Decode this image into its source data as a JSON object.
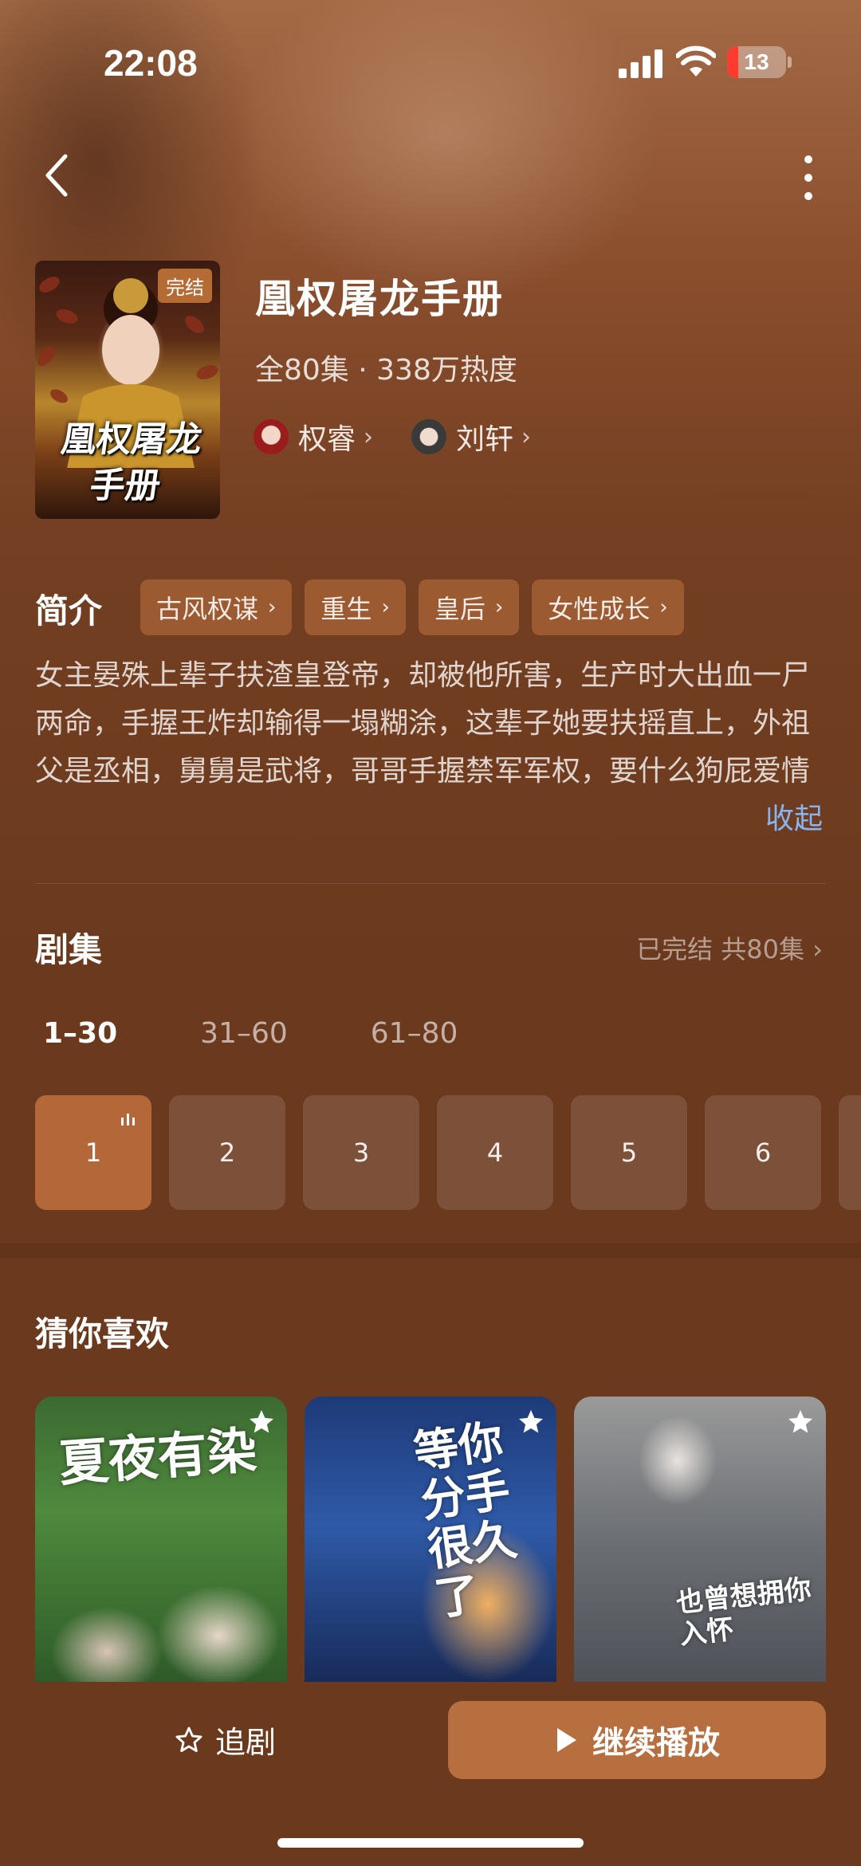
{
  "status_bar": {
    "time": "22:08",
    "battery": "13"
  },
  "show": {
    "title": "凰权屠龙手册",
    "poster_badge": "完结",
    "poster_title_line1": "凰权屠龙",
    "poster_title_line2": "手册",
    "meta": "全80集 · 338万热度",
    "cast": [
      {
        "name": "权睿"
      },
      {
        "name": "刘轩"
      }
    ]
  },
  "intro": {
    "label": "简介",
    "tags": [
      "古风权谋",
      "重生",
      "皇后",
      "女性成长"
    ],
    "synopsis": "女主晏殊上辈子扶渣皇登帝，却被他所害，生产时大出血一尸两命，手握王炸却输得一塌糊涂，这辈子她要扶摇直上，外祖父是丞相，舅舅是武将，哥哥手握禁军军权，要什么狗屁爱情",
    "collapse": "收起"
  },
  "episodes": {
    "title": "剧集",
    "status": "已完结 共80集",
    "ranges": [
      "1–30",
      "31–60",
      "61–80"
    ],
    "items": [
      "1",
      "2",
      "3",
      "4",
      "5",
      "6"
    ]
  },
  "recommend": {
    "title": "猜你喜欢",
    "cards": [
      {
        "art_text": "夏夜有染"
      },
      {
        "art_text": "等你分手很久了"
      },
      {
        "art_text": "也曾想拥你入怀"
      }
    ]
  },
  "actions": {
    "follow": "追剧",
    "continue": "继续播放"
  },
  "colors": {
    "accent": "#b86f3f",
    "background": "#6b3a1e",
    "link": "#8ab4f0"
  }
}
